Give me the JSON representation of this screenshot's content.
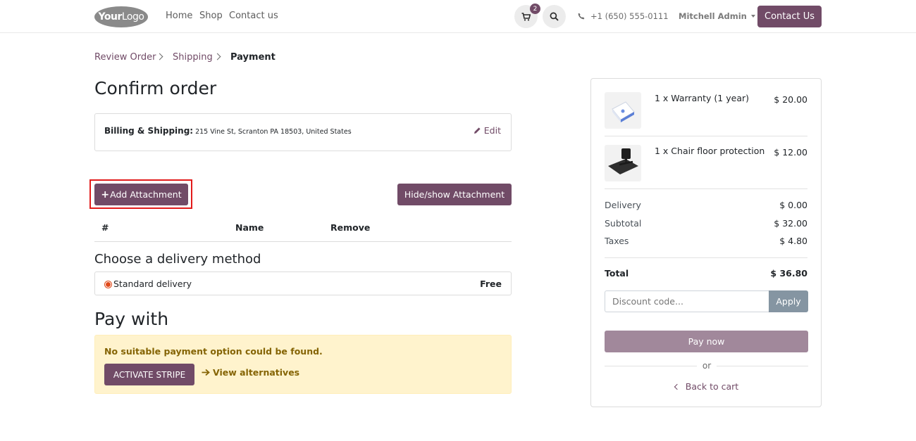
{
  "header": {
    "logo_bold": "Your",
    "logo_thin": "Logo",
    "nav": [
      "Home",
      "Shop",
      "Contact us"
    ],
    "cart_count": "2",
    "phone": "+1 (650) 555-0111",
    "user": "Mitchell Admin",
    "contact_button": "Contact Us"
  },
  "breadcrumb": [
    "Review Order",
    "Shipping",
    "Payment"
  ],
  "page_title": "Confirm order",
  "billing": {
    "label": "Billing & Shipping:",
    "address": "215 Vine St, Scranton PA 18503, United States",
    "edit": "Edit"
  },
  "attachments": {
    "add_button": "Add Attachment",
    "toggle_button": "Hide/show Attachment",
    "columns": [
      "#",
      "Name",
      "Remove"
    ]
  },
  "delivery": {
    "title": "Choose a delivery method",
    "method": "Standard delivery",
    "price": "Free"
  },
  "payment": {
    "title": "Pay with",
    "alert": "No suitable payment option could be found.",
    "activate_button": "ACTIVATE STRIPE",
    "alternatives_link": "View alternatives"
  },
  "summary": {
    "items": [
      {
        "name": "1 x Warranty (1 year)",
        "price": "$ 20.00"
      },
      {
        "name": "1 x Chair floor protection",
        "price": "$ 12.00"
      }
    ],
    "delivery_label": "Delivery",
    "delivery_value": "$ 0.00",
    "subtotal_label": "Subtotal",
    "subtotal_value": "$ 32.00",
    "taxes_label": "Taxes",
    "taxes_value": "$ 4.80",
    "total_label": "Total",
    "total_value": "$ 36.80",
    "discount_placeholder": "Discount code...",
    "apply_button": "Apply",
    "pay_button": "Pay now",
    "or_text": "or",
    "back_link": "Back to cart"
  },
  "colors": {
    "brand": "#714b67",
    "alert_bg": "#fff3cd",
    "alert_text": "#856404",
    "highlight": "#e21b1b"
  }
}
